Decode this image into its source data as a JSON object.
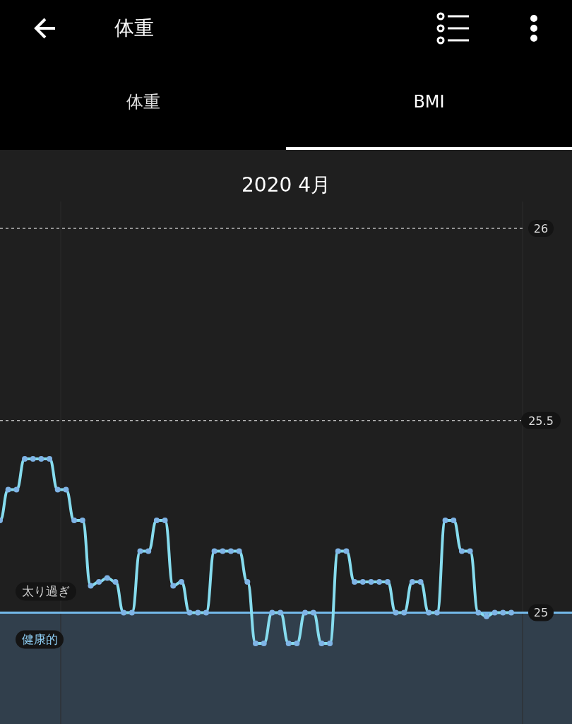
{
  "header": {
    "title": "体重"
  },
  "tabs": [
    {
      "label": "体重",
      "selected": false
    },
    {
      "label": "BMI",
      "selected": true
    }
  ],
  "chart": {
    "title": "2020 4月",
    "zones": [
      {
        "kind": "overweight",
        "label": "太り過ぎ"
      },
      {
        "kind": "healthy",
        "label": "健康的"
      }
    ],
    "chart_data": {
      "type": "line",
      "ylim": [
        24.71,
        26.07
      ],
      "yticks": [
        25,
        25.5,
        26
      ],
      "ref_lines": [
        {
          "axis": "y",
          "value": 25,
          "color": "#74b9ea"
        }
      ],
      "series": [
        {
          "color": "#86dcee",
          "marker": "circle",
          "values": [
            25.24,
            25.32,
            25.32,
            25.4,
            25.4,
            25.4,
            25.4,
            25.32,
            25.32,
            25.24,
            25.24,
            25.07,
            25.08,
            25.09,
            25.08,
            25.0,
            25.0,
            25.16,
            25.16,
            25.24,
            25.24,
            25.07,
            25.08,
            25.0,
            25.0,
            25.0,
            25.16,
            25.16,
            25.16,
            25.16,
            25.08,
            24.92,
            24.92,
            25.0,
            25.0,
            24.92,
            24.92,
            25.0,
            25.0,
            24.92,
            24.92,
            25.16,
            25.16,
            25.08,
            25.08,
            25.08,
            25.08,
            25.08,
            25.0,
            25.0,
            25.08,
            25.08,
            25.0,
            25.0,
            25.24,
            25.24,
            25.16,
            25.16,
            25.0,
            24.99,
            25.0,
            25.0,
            25.0
          ]
        }
      ]
    }
  }
}
